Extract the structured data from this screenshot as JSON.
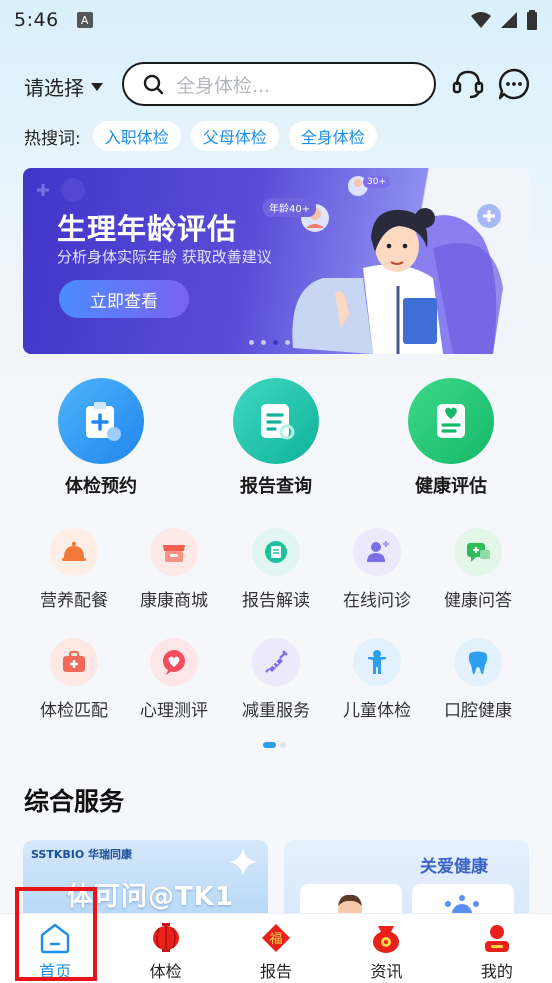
{
  "status": {
    "time": "5:46",
    "notif_icon": "A"
  },
  "header": {
    "city_label": "请选择",
    "search_placeholder": "全身体检..."
  },
  "hot": {
    "label": "热搜词:",
    "tags": [
      "入职体检",
      "父母体检",
      "全身体检"
    ]
  },
  "banner": {
    "title": "生理年龄评估",
    "subtitle": "分析身体实际年龄 获取改善建议",
    "button": "立即查看",
    "tag": "年龄40+",
    "tag2": "30+"
  },
  "main_services": [
    {
      "label": "体检预约",
      "color": "#2b9af3"
    },
    {
      "label": "报告查询",
      "color": "#19bfa6"
    },
    {
      "label": "健康评估",
      "color": "#21c27a"
    }
  ],
  "grid": [
    {
      "label": "营养配餐",
      "icon": "food-cover-icon",
      "bg": "#fdeee6",
      "fg": "#f2793a"
    },
    {
      "label": "康康商城",
      "icon": "store-icon",
      "bg": "#fde9e6",
      "fg": "#f2604f"
    },
    {
      "label": "报告解读",
      "icon": "chat-doc-icon",
      "bg": "#e2f6f1",
      "fg": "#1fbf9c"
    },
    {
      "label": "在线问诊",
      "icon": "doctor-icon",
      "bg": "#ebe9fb",
      "fg": "#7b6ee8"
    },
    {
      "label": "健康问答",
      "icon": "qa-icon",
      "bg": "#e3f6e8",
      "fg": "#2ebd5a"
    },
    {
      "label": "体检匹配",
      "icon": "medkit-icon",
      "bg": "#fde8e4",
      "fg": "#f2695a"
    },
    {
      "label": "心理测评",
      "icon": "heart-chat-icon",
      "bg": "#fde6e8",
      "fg": "#f24d5e"
    },
    {
      "label": "减重服务",
      "icon": "syringe-icon",
      "bg": "#ece9fb",
      "fg": "#7b6ee8"
    },
    {
      "label": "儿童体检",
      "icon": "child-icon",
      "bg": "#e3f1fc",
      "fg": "#2e9ef0"
    },
    {
      "label": "口腔健康",
      "icon": "tooth-icon",
      "bg": "#e3f1fc",
      "fg": "#2e9ef0"
    }
  ],
  "section": {
    "title": "综合服务"
  },
  "cards": {
    "left_logo": "SSTKBIO 华瑞同康",
    "left_title": "体可问@TK1",
    "right_title": "关爱健康"
  },
  "tabs": [
    {
      "label": "首页",
      "active": true
    },
    {
      "label": "体检",
      "active": false
    },
    {
      "label": "报告",
      "active": false
    },
    {
      "label": "资讯",
      "active": false
    },
    {
      "label": "我的",
      "active": false
    }
  ],
  "colors": {
    "accent": "#1e8fe6",
    "highlight": "#e8141a"
  }
}
